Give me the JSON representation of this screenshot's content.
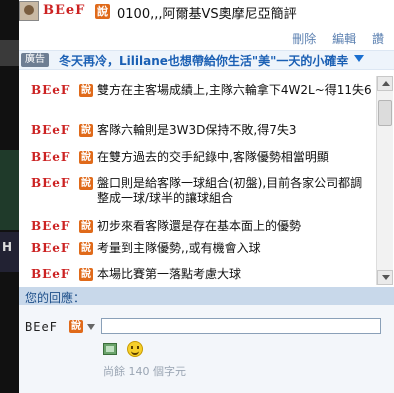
{
  "header": {
    "username": "BEeF",
    "say_label": "說",
    "title": "0100,,,阿爾基VS奧摩尼亞簡評"
  },
  "actions": {
    "delete": "刪除",
    "edit": "編輯",
    "like": "讚"
  },
  "ad": {
    "tag": "廣告",
    "text": "冬天再冷，Lililane也想帶給你生活\"美\"一天的小確幸"
  },
  "comments": [
    {
      "user": "BEeF",
      "say": "說",
      "text": "雙方在主客場成績上,主隊六輪拿下4W2L~得11失6"
    },
    {
      "user": "BEeF",
      "say": "說",
      "text": "客隊六輪則是3W3D保持不敗,得7失3"
    },
    {
      "user": "BEeF",
      "say": "說",
      "text": "在雙方過去的交手紀錄中,客隊優勢相當明顯"
    },
    {
      "user": "BEeF",
      "say": "說",
      "text": "盤口則是給客隊一球組合(初盤),目前各家公司都調整成一球/球半的讓球組合"
    },
    {
      "user": "BEeF",
      "say": "說",
      "text": "初步來看客隊還是存在基本面上的優勢"
    },
    {
      "user": "BEeF",
      "say": "說",
      "text": "考量到主隊優勢,,或有機會入球"
    },
    {
      "user": "BEeF",
      "say": "說",
      "text": "本場比賽第一落點考慮大球"
    }
  ],
  "reply": {
    "header": "您的回應：",
    "username": "BEeF",
    "say": "說",
    "input_value": "",
    "remaining": "尚餘 140 個字元"
  },
  "left_strip": {
    "text": "H"
  },
  "colors": {
    "name_red": "#cc2222",
    "say_orange": "#e06a1a",
    "link_blue": "#5a7fb0",
    "ad_blue": "#1a5fb4"
  },
  "icons": [
    "avatar",
    "image-icon",
    "smiley-icon",
    "dropdown-icon"
  ]
}
